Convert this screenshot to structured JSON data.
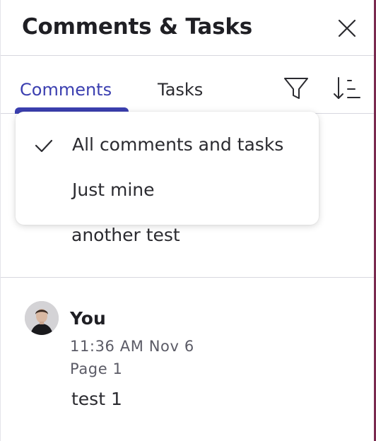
{
  "panel": {
    "title": "Comments & Tasks",
    "close_icon": "close-icon"
  },
  "tabs": [
    {
      "label": "Comments",
      "active": true
    },
    {
      "label": "Tasks",
      "active": false
    }
  ],
  "toolbar": {
    "filter_icon": "filter-icon",
    "sort_icon": "sort-icon"
  },
  "filter_menu": {
    "items": [
      {
        "label": "All comments and tasks",
        "selected": true
      },
      {
        "label": "Just mine",
        "selected": false
      }
    ]
  },
  "comments": [
    {
      "text": "another test"
    },
    {
      "author": "You",
      "time": "11:36 AM Nov 6",
      "page": "Page 1",
      "text": "test 1"
    }
  ],
  "colors": {
    "accent": "#3b3fb0",
    "divider": "#d7d7df",
    "text": "#1f1f24",
    "muted": "#5b5b66"
  }
}
